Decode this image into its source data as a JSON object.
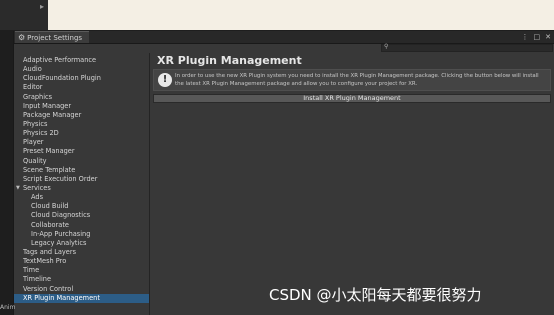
{
  "window": {
    "title": "Project Settings"
  },
  "sidebar": {
    "items": [
      {
        "label": "Adaptive Performance"
      },
      {
        "label": "Audio"
      },
      {
        "label": "CloudFoundation Plugin"
      },
      {
        "label": "Editor"
      },
      {
        "label": "Graphics"
      },
      {
        "label": "Input Manager"
      },
      {
        "label": "Package Manager"
      },
      {
        "label": "Physics"
      },
      {
        "label": "Physics 2D"
      },
      {
        "label": "Player"
      },
      {
        "label": "Preset Manager"
      },
      {
        "label": "Quality"
      },
      {
        "label": "Scene Template"
      },
      {
        "label": "Script Execution Order"
      },
      {
        "label": "Services"
      },
      {
        "label": "Ads"
      },
      {
        "label": "Cloud Build"
      },
      {
        "label": "Cloud Diagnostics"
      },
      {
        "label": "Collaborate"
      },
      {
        "label": "In-App Purchasing"
      },
      {
        "label": "Legacy Analytics"
      },
      {
        "label": "Tags and Layers"
      },
      {
        "label": "TextMesh Pro"
      },
      {
        "label": "Time"
      },
      {
        "label": "Timeline"
      },
      {
        "label": "Version Control"
      },
      {
        "label": "XR Plugin Management"
      }
    ]
  },
  "content": {
    "title": "XR Plugin Management",
    "help_text": "In order to use the new XR Plugin system you need to install the XR Plugin Management package. Clicking the button below will install the latest XR Plugin Management package and allow you to configure your project for XR.",
    "install_label": "Install XR Plugin Management"
  },
  "bottom_left_label": "Anim",
  "watermark": "CSDN @小太阳每天都要很努力",
  "colors": {
    "selected": "#2c5d87",
    "background": "#383838"
  }
}
